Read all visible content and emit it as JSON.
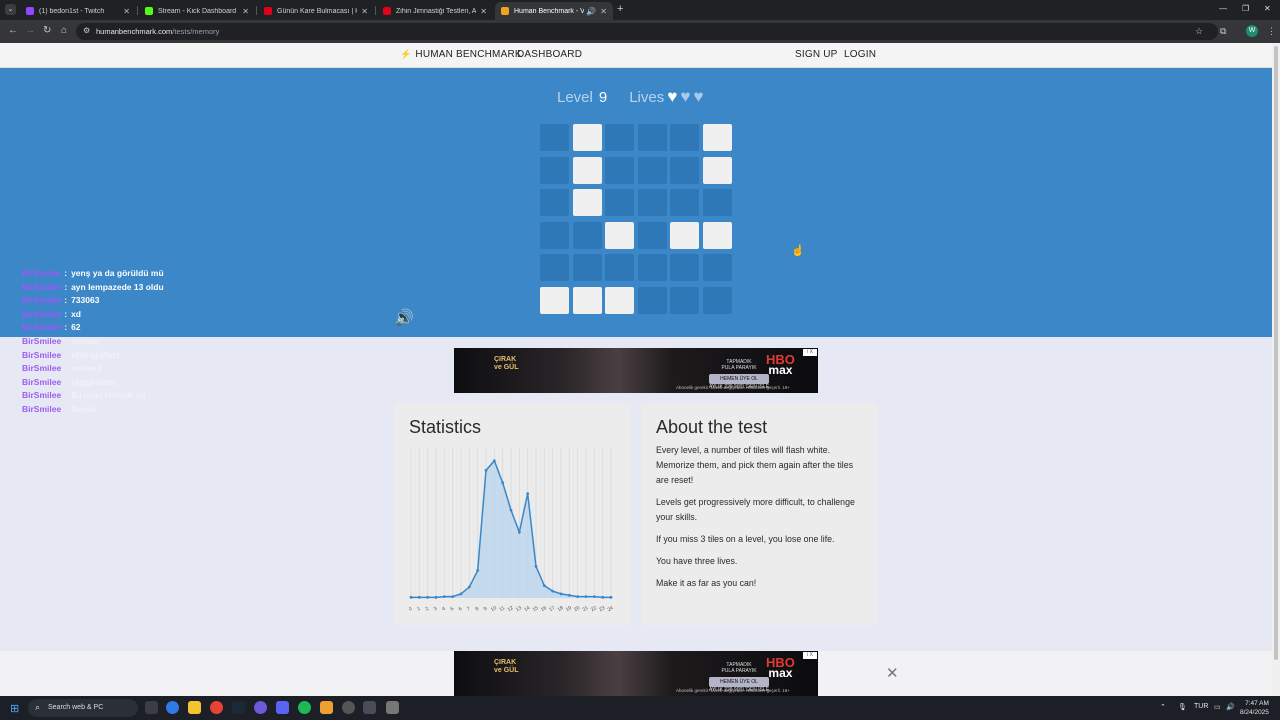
{
  "browser": {
    "tabs": [
      {
        "title": "(1) bedon1st - Twitch",
        "fav": "#9146ff"
      },
      {
        "title": "Stream - Kick Dashboard",
        "fav": "#53fc18"
      },
      {
        "title": "Günün Kare Bulmacası | HT Bul…",
        "fav": "#e3001b"
      },
      {
        "title": "Zihin Jimnastiği Testleri, Akıl &…",
        "fav": "#e3001b"
      },
      {
        "title": "Human Benchmark - Visua…",
        "fav": "#f2a51a"
      }
    ],
    "url_host": "humanbenchmark.com",
    "url_path": "/tests/memory",
    "profile_initial": "W"
  },
  "nav": {
    "brand": "HUMAN BENCHMARK",
    "dashboard": "DASHBOARD",
    "signup": "SIGN UP",
    "login": "LOGIN"
  },
  "game": {
    "level_label": "Level",
    "level": "9",
    "lives_label": "Lives",
    "lives_total": 3,
    "lives_remaining": 1,
    "grid_size": 6,
    "grid": [
      [
        0,
        1,
        0,
        0,
        0,
        1
      ],
      [
        0,
        1,
        0,
        0,
        0,
        1
      ],
      [
        0,
        1,
        0,
        0,
        0,
        0
      ],
      [
        0,
        0,
        1,
        0,
        1,
        1
      ],
      [
        0,
        0,
        0,
        0,
        0,
        0
      ],
      [
        1,
        1,
        1,
        0,
        0,
        0
      ]
    ]
  },
  "chat": [
    {
      "user": "BirSmilee",
      "msg": "yenş ya da görüldü mü",
      "faded": false
    },
    {
      "user": "BirSmilee",
      "msg": "ayn lempazede 13 oldu",
      "faded": false
    },
    {
      "user": "BirSmilee",
      "msg": "733063",
      "faded": false
    },
    {
      "user": "BirSmilee",
      "msg": "xd",
      "faded": false
    },
    {
      "user": "BirSmilee",
      "msg": "62",
      "faded": false
    },
    {
      "user": "BirSmilee",
      "msg": "mmmaj",
      "faded": true
    },
    {
      "user": "BirSmilee",
      "msg": "sfjdjhgjdjfkds",
      "faded": true
    },
    {
      "user": "BirSmilee",
      "msg": "mahmut",
      "faded": true
    },
    {
      "user": "BirSmilee",
      "msg": "sfjgjgjhjdfsfs",
      "faded": true
    },
    {
      "user": "BirSmilee",
      "msg": "Bu oyun kesindir xd",
      "faded": true
    },
    {
      "user": "BirSmilee",
      "msg": "Senvis",
      "faded": true
    }
  ],
  "ad": {
    "show_line1": "ÇIRAK",
    "show_line2": "ve GÜL",
    "cta_line1": "TAPMADIK",
    "cta_line2": "PULA PARAYIK",
    "cta_button": "HEMEN ÜYE OL",
    "cta_sub": "AYLIK 229 90TL'DEN İSLE",
    "logo_top": "HBO",
    "logo_bottom": "max",
    "fine": "Abonelik gerekir. Ücreti değişebilir. Hükümler geçerli. 18+",
    "adchoice": "i X"
  },
  "statistics": {
    "title": "Statistics"
  },
  "chart_data": {
    "type": "area",
    "title": "",
    "xlabel": "",
    "ylabel": "",
    "x": [
      0,
      1,
      2,
      3,
      4,
      5,
      6,
      7,
      8,
      9,
      10,
      11,
      12,
      13,
      14,
      15,
      16,
      17,
      18,
      19,
      20,
      21,
      22,
      23,
      24
    ],
    "tick_labels": [
      "0",
      "1",
      "2",
      "3",
      "4",
      "5",
      "6",
      "7",
      "8",
      "9",
      "10",
      "11",
      "12",
      "13",
      "14",
      "15",
      "16",
      "17",
      "18",
      "19",
      "20",
      "21",
      "22",
      "23",
      "24"
    ],
    "values": [
      0.5,
      0.5,
      0.5,
      0.5,
      1,
      1,
      3,
      8,
      20,
      93,
      100,
      84,
      64,
      48,
      76,
      23,
      9,
      5,
      3,
      2,
      1,
      1,
      1,
      0.5,
      0.5
    ],
    "ylim": [
      0,
      110
    ],
    "grid": true,
    "legend": "none",
    "color": "#3a87c8"
  },
  "about": {
    "title": "About the test",
    "paragraphs": [
      "Every level, a number of tiles will flash white. Memorize them, and pick them again after the tiles are reset!",
      "Levels get progressively more difficult, to challenge your skills.",
      "If you miss 3 tiles on a level, you lose one life.",
      "You have three lives.",
      "Make it as far as you can!"
    ]
  },
  "taskbar": {
    "search_placeholder": "Search web & PC",
    "lang": "TUR",
    "time": "7:47 AM",
    "date": "8/24/2025"
  }
}
